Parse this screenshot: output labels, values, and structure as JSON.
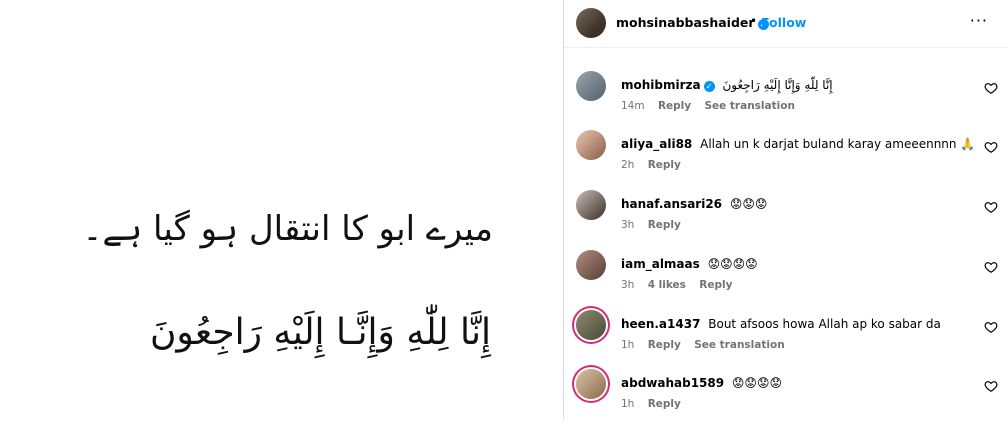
{
  "post": {
    "line1": "میرے ابو کا انتقال ہو گیا ہے۔",
    "line2": "إِنَّا لِلّٰهِ وَإِنَّـا إِلَيْهِ رَاجِعُونَ"
  },
  "header": {
    "username": "mohsinabbashaider",
    "follow_label": "Follow",
    "dot": "•",
    "more": "···"
  },
  "comments": [
    {
      "user": "mohibmirza",
      "verified": true,
      "text": "إِنَّا لِلّٰهِ وَإِنَّا إِلَيْهِ رَاجِعُونَ",
      "time": "14m",
      "reply": "Reply",
      "extra": "See translation"
    },
    {
      "user": "aliya_ali88",
      "verified": false,
      "text": "Allah un k darjat buland karay ameeennnn 🙏",
      "time": "2h",
      "reply": "Reply",
      "extra": ""
    },
    {
      "user": "hanaf.ansari26",
      "verified": false,
      "text": "😟😟😟",
      "time": "3h",
      "reply": "Reply",
      "extra": ""
    },
    {
      "user": "iam_almaas",
      "verified": false,
      "text": "😟😟😟😟",
      "time": "3h",
      "likes": "4 likes",
      "reply": "Reply",
      "extra": ""
    },
    {
      "user": "heen.a1437",
      "verified": false,
      "text": "Bout afsoos howa Allah ap ko sabar da",
      "time": "1h",
      "reply": "Reply",
      "extra": "See translation"
    },
    {
      "user": "abdwahab1589",
      "verified": false,
      "text": "😟😟😟😟",
      "time": "1h",
      "reply": "Reply",
      "extra": ""
    }
  ],
  "colors": {
    "accent": "#0095f6",
    "meta": "#737373",
    "divider": "#dbdbdb",
    "story_ring": "#d62976"
  },
  "icons": {
    "verified": "verified-badge-icon",
    "heart": "heart-icon",
    "more": "more-options-icon"
  }
}
